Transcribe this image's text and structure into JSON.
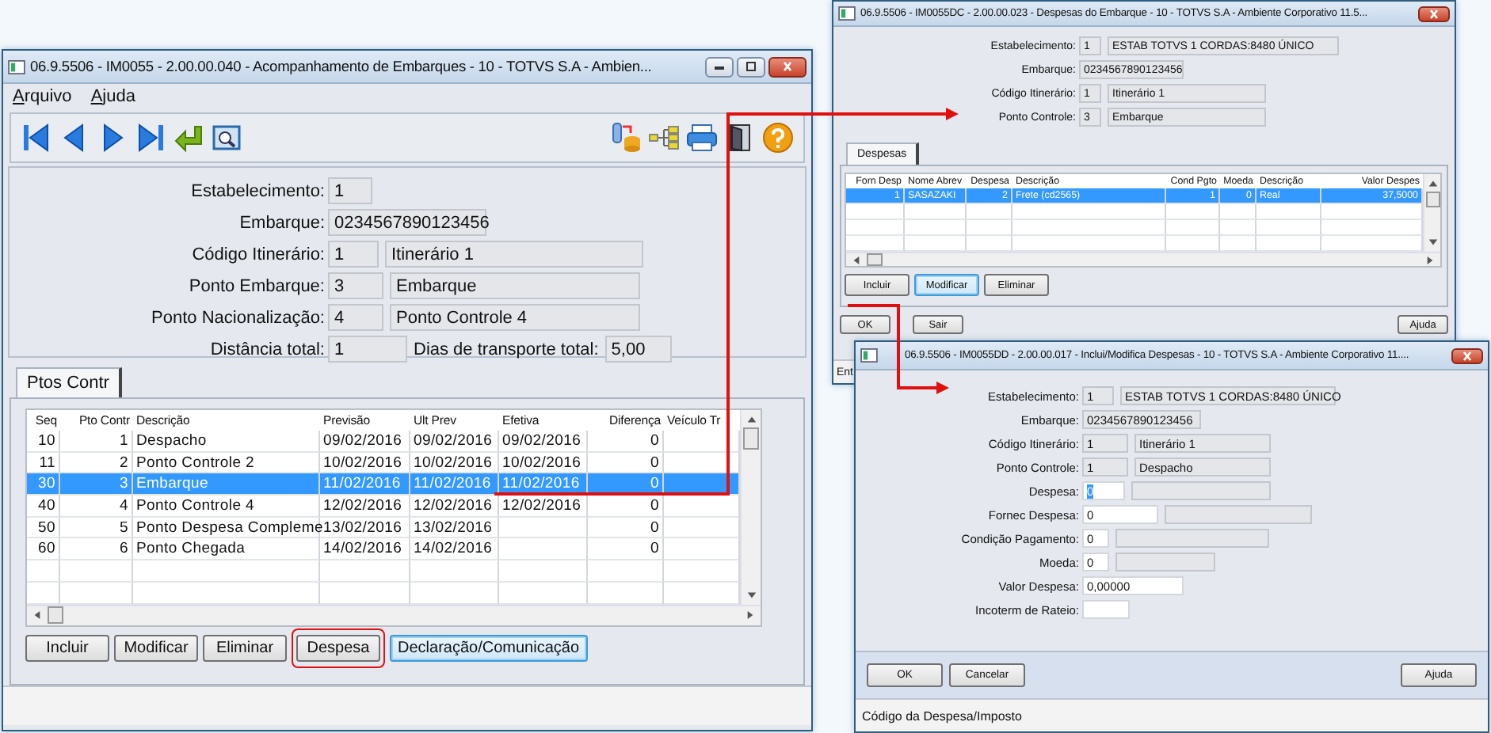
{
  "windows": [
    {
      "title": "06.9.5506 - IM0055 - 2.00.00.040 - Acompanhamento de Embarques - 10 - TOTVS S.A - Ambien...",
      "resizable": true,
      "menu": [
        "Arquivo",
        "Ajuda"
      ],
      "toolbar": true,
      "form_framed": true,
      "form": [
        {
          "label": "Estabelecimento:",
          "boxes": [
            {
              "value": "1",
              "editable": false
            }
          ]
        },
        {
          "label": "Embarque:",
          "boxes": [
            {
              "value": "0234567890123456",
              "editable": false
            }
          ]
        },
        {
          "label": "Código Itinerário:",
          "boxes": [
            {
              "value": "1",
              "editable": false
            },
            {
              "value": "Itinerário 1",
              "editable": false
            }
          ]
        },
        {
          "label": "Ponto Embarque:",
          "boxes": [
            {
              "value": "3",
              "editable": false
            },
            {
              "value": "Embarque",
              "editable": false
            }
          ]
        },
        {
          "label": "Ponto Nacionalização:",
          "boxes": [
            {
              "value": "4",
              "editable": false
            },
            {
              "value": "Ponto Controle 4",
              "editable": false
            }
          ]
        },
        {
          "label": "Distância total:",
          "boxes": [
            {
              "value": "1",
              "editable": false
            },
            {
              "label": "Dias de transporte total:",
              "value": "5,00",
              "editable": false
            }
          ]
        }
      ],
      "tabs": [
        {
          "label": "Ptos Contr",
          "selected": true
        }
      ],
      "table": {
        "columns": [
          {
            "label": "Seq",
            "numeric": true
          },
          {
            "label": "Pto Contr",
            "numeric": true
          },
          {
            "label": "Descrição",
            "numeric": false
          },
          {
            "label": "Previsão",
            "numeric": false
          },
          {
            "label": "Ult Prev",
            "numeric": false
          },
          {
            "label": "Efetiva",
            "numeric": false
          },
          {
            "label": "Diferença",
            "numeric": true
          },
          {
            "label": "Veículo Tr",
            "numeric": false
          }
        ],
        "rows": [
          {
            "cells": [
              "10",
              "1",
              "Despacho",
              "09/02/2016",
              "09/02/2016",
              "09/02/2016",
              "0",
              null
            ],
            "selected": false
          },
          {
            "cells": [
              "11",
              "2",
              "Ponto Controle 2",
              "10/02/2016",
              "10/02/2016",
              "10/02/2016",
              "0",
              null
            ],
            "selected": false
          },
          {
            "cells": [
              "30",
              "3",
              "Embarque",
              "11/02/2016",
              "11/02/2016",
              "11/02/2016",
              "0",
              null
            ],
            "selected": true
          },
          {
            "cells": [
              "40",
              "4",
              "Ponto Controle 4",
              "12/02/2016",
              "12/02/2016",
              "12/02/2016",
              "0",
              null
            ],
            "selected": false
          },
          {
            "cells": [
              "50",
              "5",
              "Ponto Despesa Compleme",
              "13/02/2016",
              "13/02/2016",
              null,
              "0",
              null
            ],
            "selected": false
          },
          {
            "cells": [
              "60",
              "6",
              "Ponto Chegada",
              "14/02/2016",
              "14/02/2016",
              null,
              "0",
              null
            ],
            "selected": false
          }
        ]
      },
      "buttons": [
        {
          "label": "Incluir",
          "focused": false,
          "highlighted": false
        },
        {
          "label": "Modificar",
          "focused": false,
          "highlighted": false
        },
        {
          "label": "Eliminar",
          "focused": false,
          "highlighted": false
        },
        {
          "label": "Despesa",
          "focused": false,
          "highlighted": true
        },
        {
          "label": "Declaração/Comunicação",
          "focused": true,
          "highlighted": false
        }
      ]
    },
    {
      "title": "06.9.5506 - IM0055DC - 2.00.00.023 - Despesas do Embarque - 10 - TOTVS S.A - Ambiente Corporativo 11.5...",
      "resizable": false,
      "form_framed": false,
      "form": [
        {
          "label": "Estabelecimento:",
          "boxes": [
            {
              "value": "1",
              "editable": false
            },
            {
              "value": "ESTAB TOTVS 1 CORDAS:8480 ÚNICO",
              "editable": false
            }
          ]
        },
        {
          "label": "Embarque:",
          "boxes": [
            {
              "value": "0234567890123456",
              "editable": false
            }
          ]
        },
        {
          "label": "Código Itinerário:",
          "boxes": [
            {
              "value": "1",
              "editable": false
            },
            {
              "value": "Itinerário 1",
              "editable": false
            }
          ]
        },
        {
          "label": "Ponto Controle:",
          "boxes": [
            {
              "value": "3",
              "editable": false
            },
            {
              "value": "Embarque",
              "editable": false
            }
          ]
        }
      ],
      "tabs": [
        {
          "label": "Despesas",
          "selected": true
        }
      ],
      "table": {
        "columns": [
          {
            "label": "Forn Desp",
            "numeric": true
          },
          {
            "label": "Nome Abrev",
            "numeric": false
          },
          {
            "label": "Despesa",
            "numeric": true
          },
          {
            "label": "Descrição",
            "numeric": false
          },
          {
            "label": "Cond Pgto",
            "numeric": true
          },
          {
            "label": "Moeda",
            "numeric": true
          },
          {
            "label": "Descrição",
            "numeric": false
          },
          {
            "label": "Valor Despes",
            "numeric": true
          }
        ],
        "rows": [
          {
            "cells": [
              "1",
              "SASAZAKI",
              "2",
              "Frete (cd2565)",
              "1",
              "0",
              "Real",
              "37,5000"
            ],
            "selected": true
          }
        ]
      },
      "buttons": [
        {
          "label": "Incluir",
          "focused": false,
          "highlighted": false
        },
        {
          "label": "Modificar",
          "focused": true,
          "highlighted": false
        },
        {
          "label": "Eliminar",
          "focused": false,
          "highlighted": false
        }
      ],
      "footer_buttons": [
        "OK",
        "Sair",
        "Ajuda"
      ],
      "status": "Ent"
    },
    {
      "title": "06.9.5506 - IM0055DD - 2.00.00.017 - Inclui/Modifica Despesas - 10 - TOTVS S.A - Ambiente Corporativo 11....",
      "resizable": false,
      "form_framed": false,
      "form": [
        {
          "label": "Estabelecimento:",
          "boxes": [
            {
              "value": "1",
              "editable": false
            },
            {
              "value": "ESTAB TOTVS 1 CORDAS:8480 ÚNICO",
              "editable": false
            }
          ]
        },
        {
          "label": "Embarque:",
          "boxes": [
            {
              "value": "0234567890123456",
              "editable": false
            }
          ]
        },
        {
          "label": "Código Itinerário:",
          "boxes": [
            {
              "value": "1",
              "editable": false
            },
            {
              "value": "Itinerário 1",
              "editable": false
            }
          ]
        },
        {
          "label": "Ponto Controle:",
          "boxes": [
            {
              "value": "1",
              "editable": false
            },
            {
              "value": "Despacho",
              "editable": false
            }
          ]
        },
        {
          "label": "Despesa:",
          "boxes": [
            {
              "value": "0",
              "editable": true,
              "focused": true
            },
            {
              "editable": false
            }
          ]
        },
        {
          "label": "Fornec Despesa:",
          "boxes": [
            {
              "value": "0",
              "editable": true,
              "focused": false
            },
            {
              "editable": false
            }
          ]
        },
        {
          "label": "Condição Pagamento:",
          "boxes": [
            {
              "value": "0",
              "editable": true,
              "focused": false
            },
            {
              "editable": false
            }
          ]
        },
        {
          "label": "Moeda:",
          "boxes": [
            {
              "value": "0",
              "editable": true,
              "focused": false
            },
            {
              "editable": false
            }
          ]
        },
        {
          "label": "Valor Despesa:",
          "boxes": [
            {
              "value": "0,00000",
              "editable": true,
              "focused": false
            }
          ]
        },
        {
          "label": "Incoterm de Rateio:",
          "boxes": [
            {
              "editable": true
            }
          ]
        }
      ],
      "footer_buttons": [
        "OK",
        "Cancelar",
        "Ajuda"
      ],
      "status": "Código da Despesa/Imposto"
    }
  ]
}
